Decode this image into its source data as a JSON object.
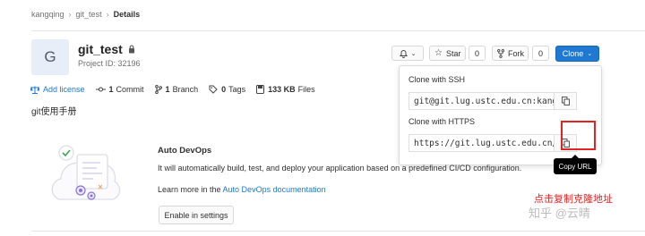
{
  "breadcrumb": {
    "items": [
      "kangqing",
      "git_test",
      "Details"
    ]
  },
  "project": {
    "avatar_letter": "G",
    "name": "git_test",
    "id_text": "Project ID: 32196",
    "description": "git使用手册"
  },
  "stats": {
    "license": "Add license",
    "commits_count": "1",
    "commits_label": "Commit",
    "branches_count": "1",
    "branches_label": "Branch",
    "tags_count": "0",
    "tags_label": "Tags",
    "files_size": "133 KB",
    "files_label": "Files"
  },
  "actions": {
    "star_label": "Star",
    "star_count": "0",
    "fork_label": "Fork",
    "fork_count": "0",
    "clone_label": "Clone"
  },
  "clone_dropdown": {
    "ssh_label": "Clone with SSH",
    "ssh_url": "git@git.lug.ustc.edu.cn:kang",
    "https_label": "Clone with HTTPS",
    "https_url": "https://git.lug.ustc.edu.cn/",
    "tooltip": "Copy URL"
  },
  "auto_devops": {
    "title": "Auto DevOps",
    "text": "It will automatically build, test, and deploy your application based on a predefined CI/CD configuration.",
    "learn_prefix": "Learn more in the ",
    "learn_link": "Auto DevOps documentation",
    "button": "Enable in settings"
  },
  "annotation": {
    "note": "点击复制克隆地址",
    "watermark": "知乎 @云晴"
  },
  "colors": {
    "accent": "#1f78d1",
    "highlight": "#e02424",
    "tooltip_bg": "#000000"
  }
}
